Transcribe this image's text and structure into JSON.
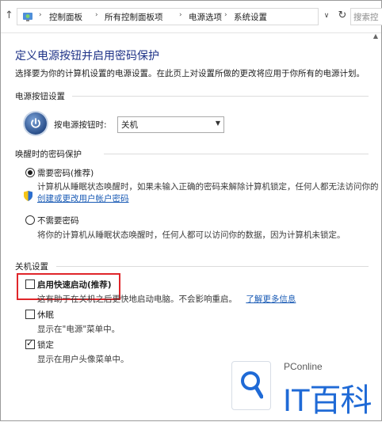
{
  "address_bar": {
    "breadcrumbs": [
      "控制面板",
      "所有控制面板项",
      "电源选项",
      "系统设置"
    ],
    "search_placeholder": "搜索控"
  },
  "page": {
    "title": "定义电源按钮并启用密码保护",
    "description": "选择要为你的计算机设置的电源设置。在此页上对设置所做的更改将应用于你所有的电源计划。"
  },
  "power_button": {
    "section_label": "电源按钮设置",
    "field_label": "按电源按钮时:",
    "selected_value": "关机"
  },
  "wake_password": {
    "section_label": "唤醒时的密码保护",
    "options": [
      {
        "label": "需要密码(推荐)",
        "selected": true,
        "description": "计算机从睡眠状态唤醒时，如果未输入正确的密码来解除计算机锁定，任何人都无法访问你的",
        "link": "创建或更改用户帐户密码"
      },
      {
        "label": "不需要密码",
        "selected": false,
        "description": "将你的计算机从睡眠状态唤醒时，任何人都可以访问你的数据，因为计算机未锁定。"
      }
    ]
  },
  "shutdown": {
    "section_label": "关机设置",
    "items": [
      {
        "label": "启用快速启动(推荐)",
        "checked": false,
        "description": "这有助于在关机之后更快地启动电脑。不会影响重启。",
        "link": "了解更多信息"
      },
      {
        "label": "休眠",
        "checked": false,
        "description": "显示在\"电源\"菜单中。"
      },
      {
        "label": "锁定",
        "checked": true,
        "description": "显示在用户头像菜单中。"
      }
    ]
  },
  "watermark": {
    "brand": "PConline",
    "big": "IT百科"
  },
  "colors": {
    "title": "#1e3287",
    "link": "#1a5bb5",
    "highlight_box": "#e0262a",
    "watermark_blue": "#1f6ad6"
  }
}
